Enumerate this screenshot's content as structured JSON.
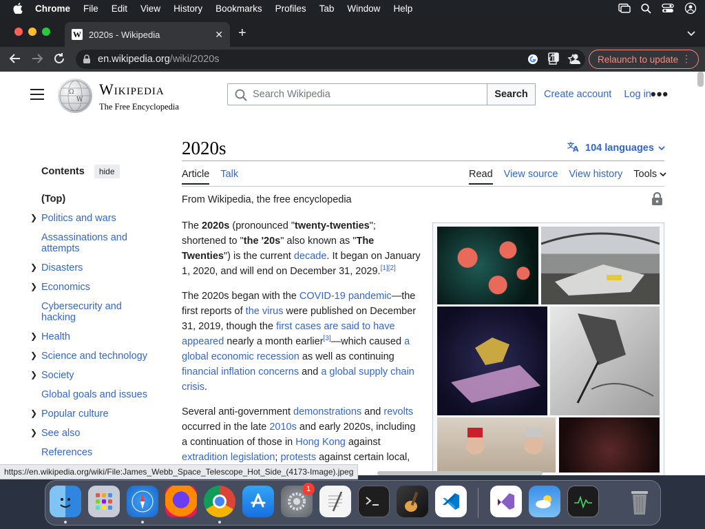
{
  "menubar": {
    "app": "Chrome",
    "items": [
      "File",
      "Edit",
      "View",
      "History",
      "Bookmarks",
      "Profiles",
      "Tab",
      "Window",
      "Help"
    ]
  },
  "browser": {
    "tab_title": "2020s - Wikipedia",
    "url_host": "en.wikipedia.org",
    "url_path": "/wiki/2020s",
    "relaunch_label": "Relaunch to update"
  },
  "wiki": {
    "wordmark": "Wikipedia",
    "tagline": "The Free Encyclopedia",
    "search_placeholder": "Search Wikipedia",
    "search_button": "Search",
    "create_account": "Create account",
    "log_in": "Log in"
  },
  "toc": {
    "title": "Contents",
    "hide_label": "hide",
    "items": [
      {
        "label": "(Top)",
        "expandable": false
      },
      {
        "label": "Politics and wars",
        "expandable": true
      },
      {
        "label": "Assassinations and attempts",
        "expandable": false
      },
      {
        "label": "Disasters",
        "expandable": true
      },
      {
        "label": "Economics",
        "expandable": true
      },
      {
        "label": "Cybersecurity and hacking",
        "expandable": false
      },
      {
        "label": "Health",
        "expandable": true
      },
      {
        "label": "Science and technology",
        "expandable": true
      },
      {
        "label": "Society",
        "expandable": true
      },
      {
        "label": "Global goals and issues",
        "expandable": false
      },
      {
        "label": "Popular culture",
        "expandable": true
      },
      {
        "label": "See also",
        "expandable": true
      },
      {
        "label": "References",
        "expandable": false
      }
    ]
  },
  "article": {
    "title": "2020s",
    "languages": "104 languages",
    "tab_article": "Article",
    "tab_talk": "Talk",
    "tab_read": "Read",
    "tab_view_source": "View source",
    "tab_view_history": "View history",
    "tab_tools": "Tools",
    "from_line": "From Wikipedia, the free encyclopedia",
    "p1": {
      "a": "The ",
      "b_2020s": "2020s",
      "c": " (pronounced \"",
      "b_tt": "twenty-twenties",
      "d": "\"; shortened to \"",
      "b_20s": "the '20s",
      "e": "\" also known as \"",
      "b_twenties": "The Twenties",
      "f": "\") is the current ",
      "link_decade": "decade",
      "g": ". It began on January 1, 2020, and will end on December 31, 2029.",
      "ref": "[1][2]"
    },
    "p2": {
      "a": "The 2020s began with the ",
      "link_covid": "COVID-19 pandemic",
      "b": "—the first reports of ",
      "link_virus": "the virus",
      "c": " were published on December 31, 2019, though the ",
      "link_first": "first cases are said to have appeared",
      "d": " nearly a month earlier",
      "ref": "[3]",
      "e": "—which caused ",
      "link_recession": "a global economic recession",
      "f": " as well as continuing ",
      "link_inflation": "financial inflation concerns",
      "g": " and ",
      "link_supply": "a global supply chain crisis",
      "h": "."
    },
    "p3": {
      "a": "Several anti-government ",
      "link_demos": "demonstrations",
      "b": " and ",
      "link_revolts": "revolts",
      "c": " occurred in the late ",
      "link_2010s": "2010s",
      "d": " and early 2020s, including a continuation of those in ",
      "link_hk": "Hong Kong",
      "e": " against ",
      "link_extradition": "extradition legislation",
      "f": "; ",
      "link_protests": "protests",
      "g": " against certain local, state and"
    }
  },
  "status_url": "https://en.wikipedia.org/wiki/File:James_Webb_Space_Telescope_Hot_Side_(4173-Image).jpeg",
  "dock": {
    "apps": [
      "finder-icon",
      "launchpad-icon",
      "safari-icon",
      "firefox-icon",
      "chrome-icon",
      "app-store-icon",
      "system-settings-icon",
      "textedit-icon",
      "terminal-icon",
      "garageband-icon",
      "vscode-icon",
      "visual-studio-icon",
      "weather-icon",
      "activity-monitor-icon",
      "trash-icon"
    ],
    "badge": "1"
  },
  "colors": {
    "link": "#3366cc",
    "relaunch": "#f28b82"
  }
}
